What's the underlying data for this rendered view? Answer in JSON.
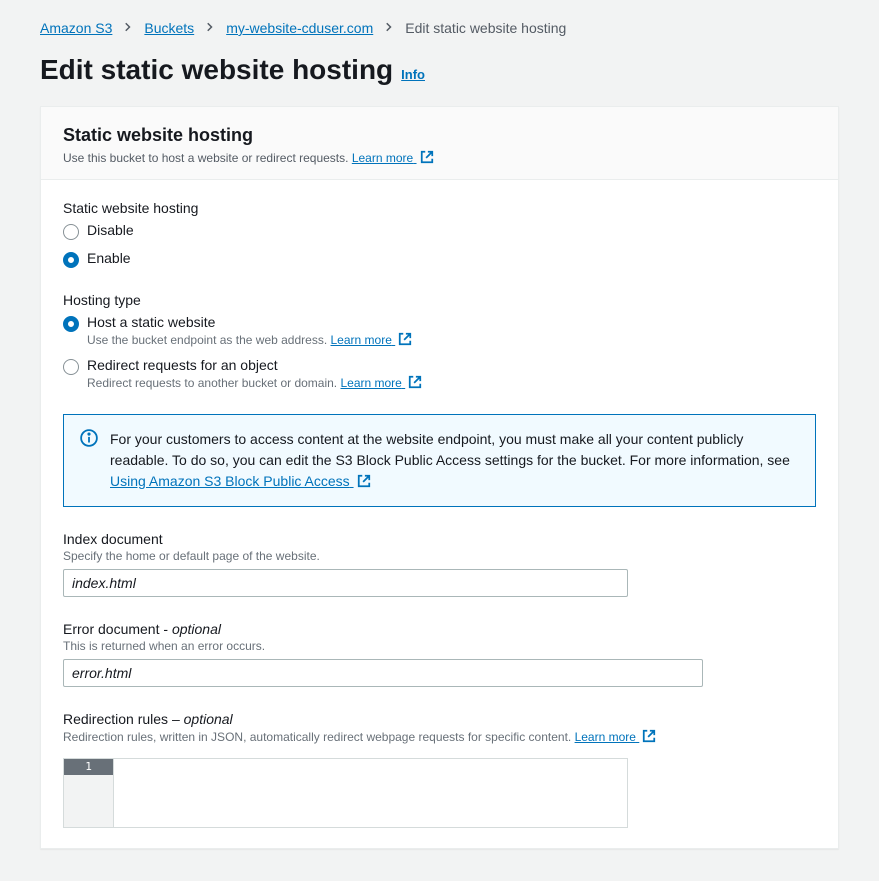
{
  "breadcrumb": {
    "items": [
      {
        "label": "Amazon S3",
        "link": true
      },
      {
        "label": "Buckets",
        "link": true
      },
      {
        "label": "my-website-cduser.com",
        "link": true
      },
      {
        "label": "Edit static website hosting",
        "link": false
      }
    ]
  },
  "page": {
    "title": "Edit static website hosting",
    "info": "Info"
  },
  "panel": {
    "title": "Static website hosting",
    "subtitle": "Use this bucket to host a website or redirect requests.",
    "learn_more": "Learn more"
  },
  "hosting": {
    "label": "Static website hosting",
    "disable": "Disable",
    "enable": "Enable",
    "selected": "enable"
  },
  "hosting_type": {
    "label": "Hosting type",
    "host_title": "Host a static website",
    "host_desc": "Use the bucket endpoint as the web address.",
    "host_learn": "Learn more",
    "redirect_title": "Redirect requests for an object",
    "redirect_desc": "Redirect requests to another bucket or domain.",
    "redirect_learn": "Learn more",
    "selected": "host"
  },
  "alert": {
    "text_before": "For your customers to access content at the website endpoint, you must make all your content publicly readable. To do so, you can edit the S3 Block Public Access settings for the bucket. For more information, see ",
    "link": "Using Amazon S3 Block Public Access"
  },
  "index_doc": {
    "label": "Index document",
    "sub": "Specify the home or default page of the website.",
    "value": "index.html"
  },
  "error_doc": {
    "label_main": "Error document - ",
    "label_opt": "optional",
    "sub": "This is returned when an error occurs.",
    "value": "error.html"
  },
  "redirection": {
    "label_main": "Redirection rules – ",
    "label_opt": "optional",
    "sub": "Redirection rules, written in JSON, automatically redirect webpage requests for specific content.",
    "learn": "Learn more",
    "line_number": "1"
  }
}
